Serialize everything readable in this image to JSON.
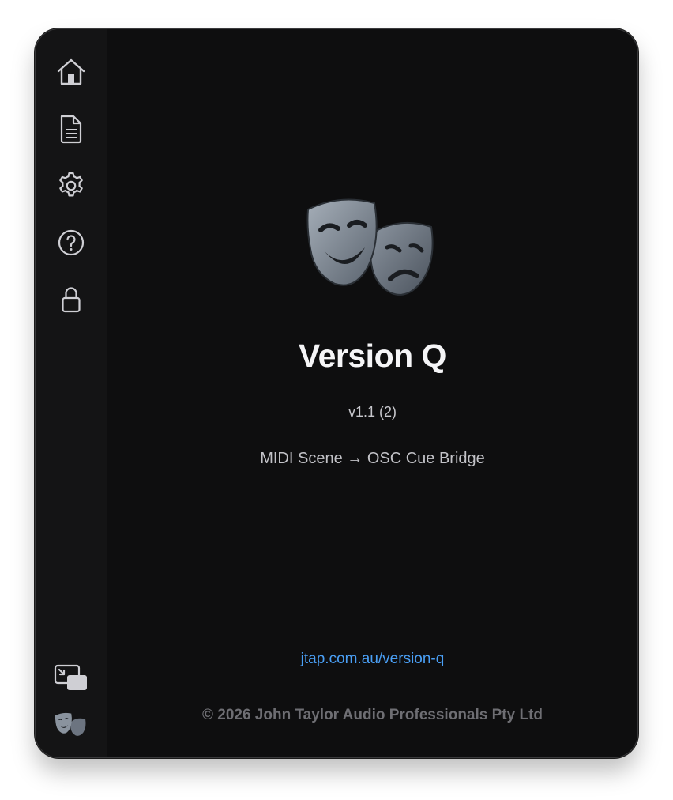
{
  "sidebar": {
    "items": [
      {
        "icon": "home-icon"
      },
      {
        "icon": "document-icon"
      },
      {
        "icon": "gear-icon"
      },
      {
        "icon": "help-icon"
      },
      {
        "icon": "lock-icon"
      }
    ],
    "bottom_items": [
      {
        "icon": "picture-in-picture-icon"
      },
      {
        "icon": "theater-masks-icon"
      }
    ]
  },
  "about": {
    "app_name": "Version Q",
    "version": "v1.1 (2)",
    "tagline": "MIDI Scene → OSC Cue Bridge",
    "link": "jtap.com.au/version-q",
    "copyright": "© 2026 John Taylor Audio Professionals Pty Ltd"
  },
  "colors": {
    "background": "#0e0e0f",
    "sidebar": "#141415",
    "link": "#4a9ff5",
    "title": "#f5f5f7",
    "muted": "#6e6e73"
  }
}
